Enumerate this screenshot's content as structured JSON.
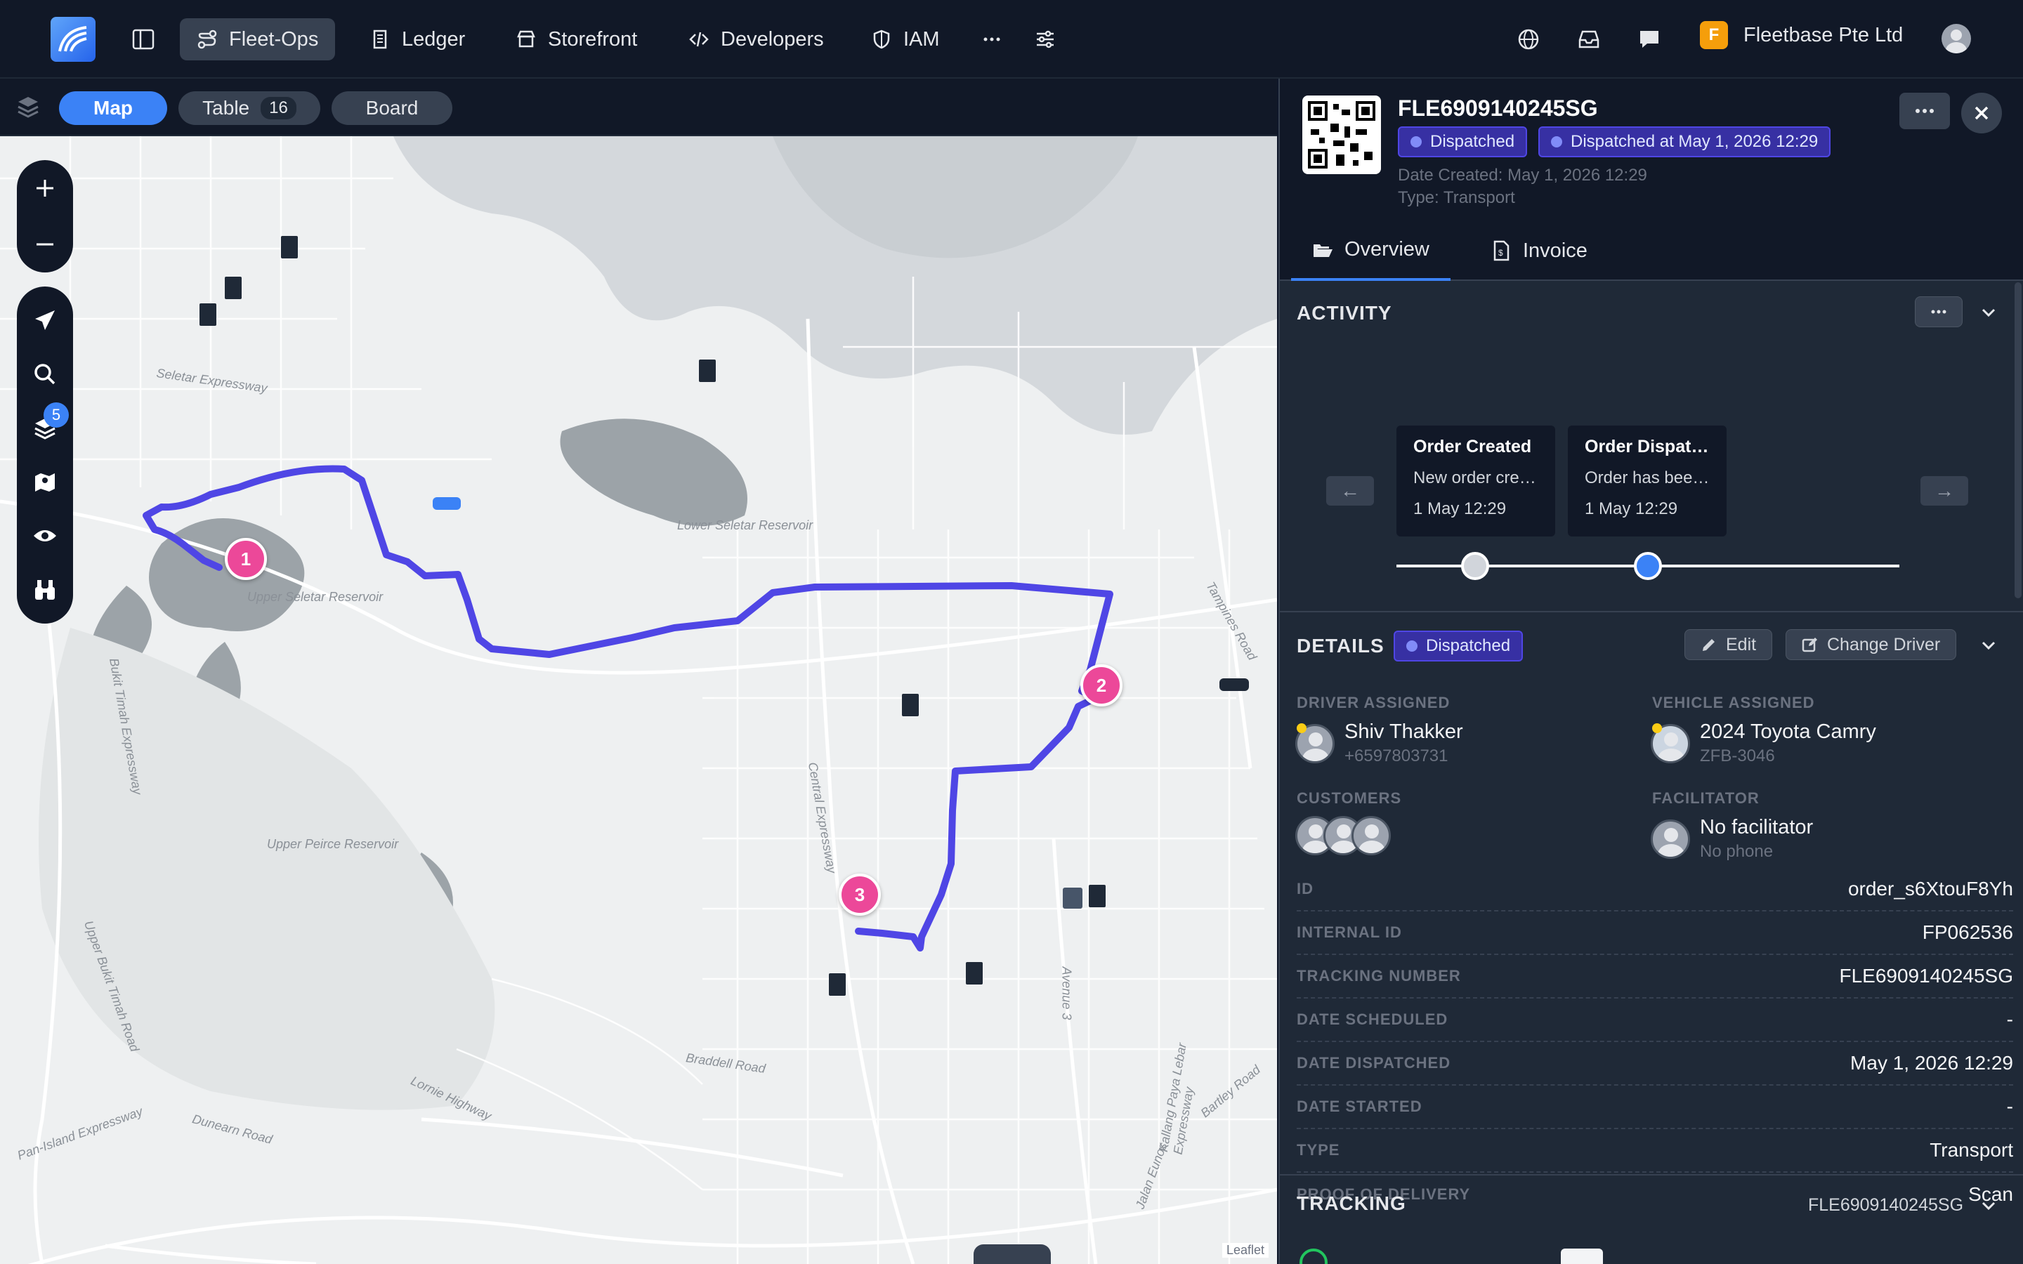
{
  "nav": {
    "items": [
      {
        "label": "Fleet-Ops"
      },
      {
        "label": "Ledger"
      },
      {
        "label": "Storefront"
      },
      {
        "label": "Developers"
      },
      {
        "label": "IAM"
      }
    ],
    "org_initial": "F",
    "org_name": "Fleetbase Pte Ltd"
  },
  "views": {
    "map": "Map",
    "table": "Table",
    "table_count": "16",
    "board": "Board"
  },
  "map": {
    "layers_badge": "5",
    "stops": [
      "1",
      "2",
      "3"
    ],
    "labels": [
      "Seletar Expressway",
      "Lower Seletar Reservoir",
      "Upper Seletar Reservoir",
      "Upper Peirce Reservoir",
      "Central Expressway",
      "Bukit Timah Expressway",
      "Braddell Road",
      "Dunearn Road",
      "Pan-Island Expressway",
      "Lornie Highway",
      "Upper Bukit Timah Road",
      "Bartley Road",
      "Tampines Road",
      "Kallang Paya Lebar Expressway",
      "Avenue 3",
      "Jalan Eunos",
      "Leaflet"
    ],
    "route_color": "#4f46e5",
    "marker_color": "#ec4899"
  },
  "order": {
    "id": "FLE6909140245SG",
    "status": "Dispatched",
    "dispatched_at": "Dispatched at May 1, 2026 12:29",
    "date_created": "Date Created: May 1, 2026 12:29",
    "type_line": "Type: Transport"
  },
  "tabs": {
    "overview": "Overview",
    "invoice": "Invoice"
  },
  "activity": {
    "title": "ACTIVITY",
    "cards": [
      {
        "title": "Order Created",
        "desc": "New order created.",
        "time": "1 May 12:29"
      },
      {
        "title": "Order Dispatched",
        "desc": "Order has been dispatched.",
        "time": "1 May 12:29"
      }
    ],
    "prev": "←",
    "next": "→"
  },
  "details": {
    "title": "DETAILS",
    "status": "Dispatched",
    "edit": "Edit",
    "change_driver": "Change Driver",
    "driver_label": "DRIVER ASSIGNED",
    "driver_name": "Shiv Thakker",
    "driver_phone": "+6597803731",
    "vehicle_label": "VEHICLE ASSIGNED",
    "vehicle_name": "2024 Toyota Camry",
    "vehicle_plate": "ZFB-3046",
    "customers_label": "CUSTOMERS",
    "facilitator_label": "FACILITATOR",
    "facilitator_name": "No facilitator",
    "facilitator_phone": "No phone",
    "rows": [
      {
        "k": "ID",
        "v": "order_s6XtouF8Yh"
      },
      {
        "k": "INTERNAL ID",
        "v": "FP062536"
      },
      {
        "k": "TRACKING NUMBER",
        "v": "FLE6909140245SG"
      },
      {
        "k": "DATE SCHEDULED",
        "v": "-"
      },
      {
        "k": "DATE DISPATCHED",
        "v": "May 1, 2026 12:29"
      },
      {
        "k": "DATE STARTED",
        "v": "-"
      },
      {
        "k": "TYPE",
        "v": "Transport"
      },
      {
        "k": "PROOF OF DELIVERY",
        "v": "Scan"
      }
    ]
  },
  "tracking": {
    "title": "TRACKING",
    "number": "FLE6909140245SG"
  }
}
